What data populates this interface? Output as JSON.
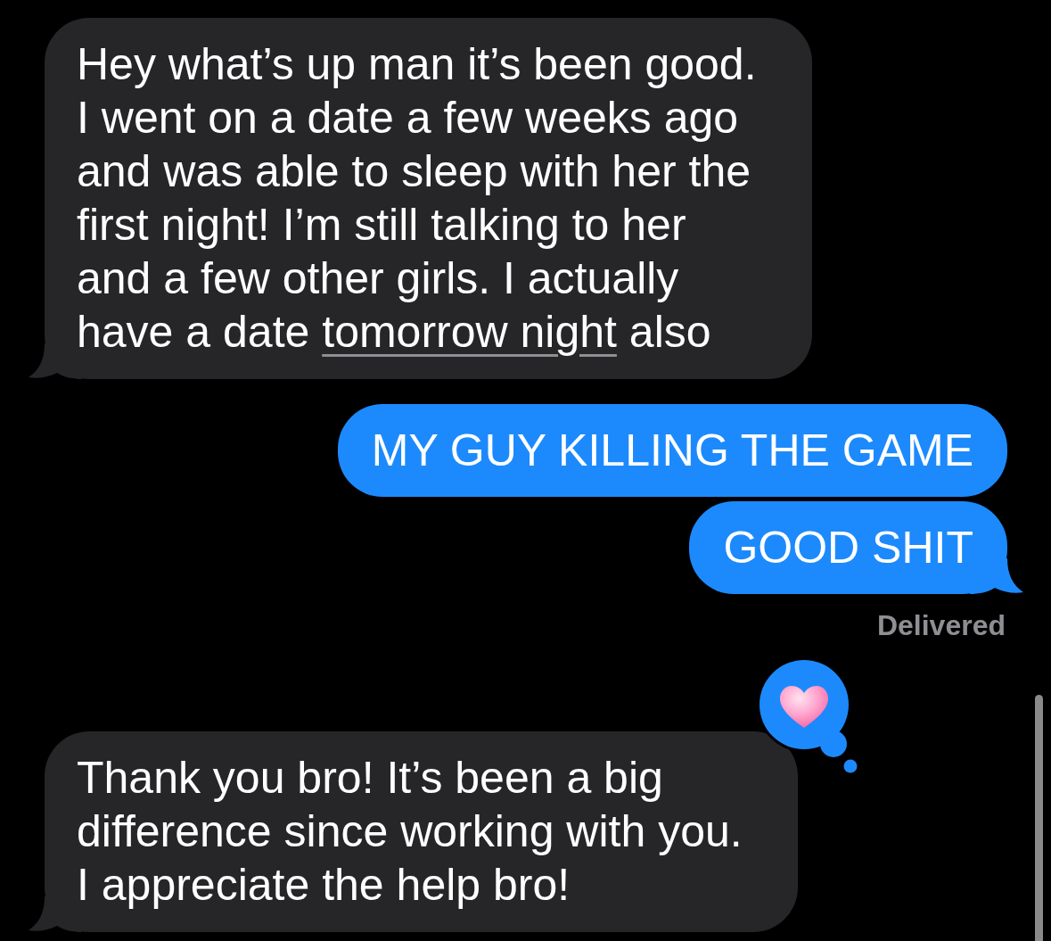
{
  "messages": [
    {
      "kind": "incoming",
      "tail": true,
      "parts": [
        {
          "text": "Hey what’s up man it’s been good.\nI went on a date a few weeks ago\nand was able to sleep with her the\nfirst night! I’m still talking to her\nand a few other girls. I actually\nhave a date ",
          "link": false
        },
        {
          "text": "tomorrow night",
          "link": true
        },
        {
          "text": " also",
          "link": false
        }
      ]
    },
    {
      "kind": "outgoing",
      "tail": false,
      "parts": [
        {
          "text": "MY GUY KILLING THE GAME",
          "link": false
        }
      ]
    },
    {
      "kind": "outgoing",
      "tail": true,
      "parts": [
        {
          "text": "GOOD SHIT",
          "link": false
        }
      ],
      "status": "Delivered"
    },
    {
      "kind": "incoming",
      "tail": true,
      "reaction": {
        "kind": "heart"
      },
      "parts": [
        {
          "text": "Thank you bro! It’s been a big\ndifference since working with you.\nI appreciate the help bro!",
          "link": false
        }
      ]
    }
  ]
}
